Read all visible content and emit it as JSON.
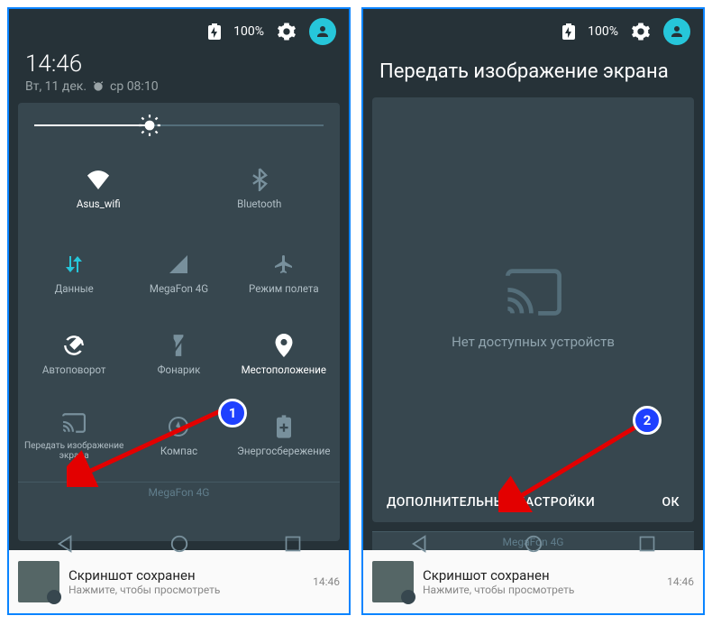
{
  "left": {
    "battery_pct": "100%",
    "time": "14:46",
    "date_prefix": "Вт, 11 дек.",
    "alarm_text": "ср 08:10",
    "brightness_pct": 40,
    "qs": {
      "wifi": "Asus_wifi",
      "bt": "Bluetooth",
      "data": "Данные",
      "signal": "MegaFon 4G",
      "air": "Режим полета",
      "rotate": "Автоповорот",
      "flash": "Фонарик",
      "location": "Местоположение",
      "cast": "Передать изображение экрана",
      "compass": "Компас",
      "battery": "Энергосбережение"
    },
    "carrier": "MegaFon 4G",
    "notif_title": "Скриншот сохранен",
    "notif_sub": "Нажмите, чтобы просмотреть",
    "notif_time": "14:46"
  },
  "right": {
    "battery_pct": "100%",
    "title": "Передать изображение экрана",
    "empty": "Нет доступных устройств",
    "more": "ДОПОЛНИТЕЛЬНЫЕ НАСТРОЙКИ",
    "ok": "ОК",
    "carrier": "MegaFon 4G",
    "notif_title": "Скриншот сохранен",
    "notif_sub": "Нажмите, чтобы просмотреть",
    "notif_time": "14:46"
  },
  "annotations": {
    "badge1": "1",
    "badge2": "2"
  }
}
